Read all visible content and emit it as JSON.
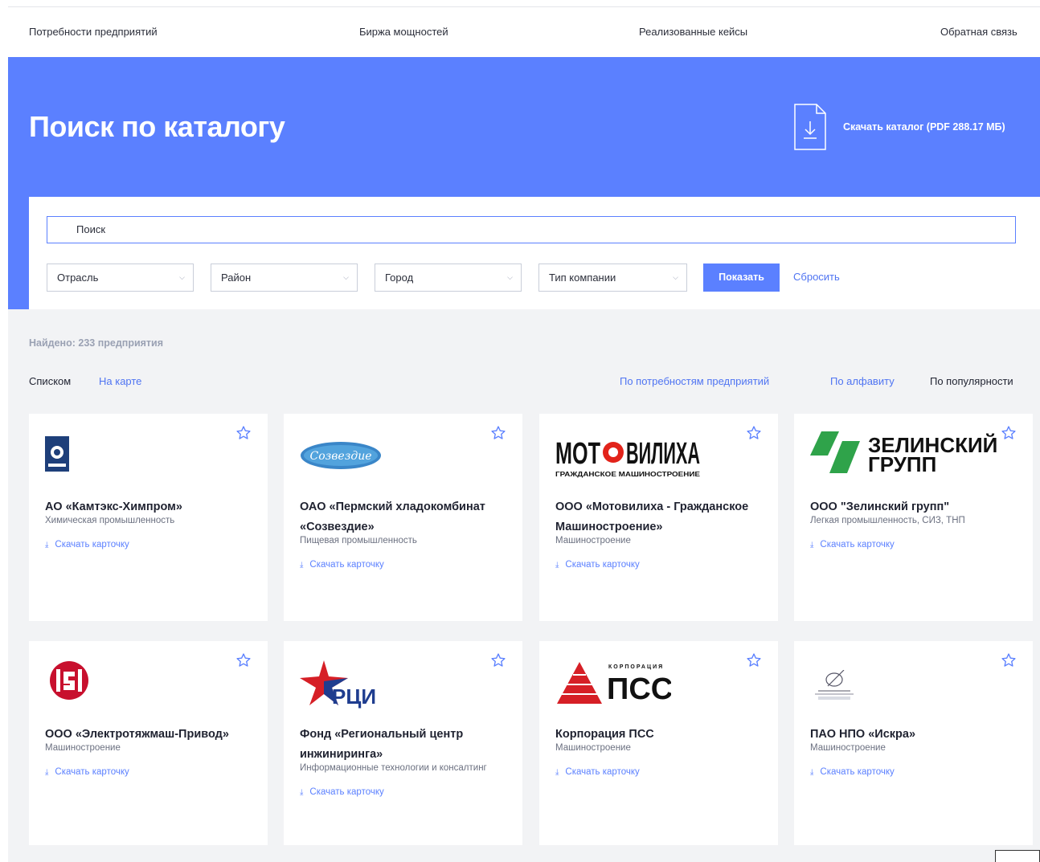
{
  "nav": {
    "items": [
      "Потребности предприятий",
      "Биржа мощностей",
      "Реализованные кейсы",
      "Обратная связь"
    ]
  },
  "hero": {
    "title": "Поиск по каталогу",
    "download_label": "Скачать каталог (PDF 288.17 МБ)"
  },
  "search": {
    "placeholder": "Поиск",
    "filters": [
      "Отрасль",
      "Район",
      "Город",
      "Тип компании"
    ],
    "show_button": "Показать",
    "reset_link": "Сбросить"
  },
  "results": {
    "found_text": "Найдено: 233 предприятия",
    "view_list": "Списком",
    "view_map": "На карте",
    "sort_needs": "По потребностям предприятий",
    "sort_alpha": "По алфавиту",
    "sort_popular": "По популярности"
  },
  "cards": [
    {
      "name": "АО «Камтэкс-Химпром»",
      "industry": "Химическая промышленность",
      "download": "Скачать карточку",
      "logo_icon": "kamteks-logo-icon"
    },
    {
      "name": "ОАО «Пермский хладокомбинат «Созвездие»",
      "industry": "Пищевая промышленность",
      "download": "Скачать карточку",
      "logo_icon": "sozvezdie-logo-icon",
      "logo_text": "Созвездие"
    },
    {
      "name": "ООО «Мотовилиха - Гражданское Машиностроение»",
      "industry": "Машиностроение",
      "download": "Скачать карточку",
      "logo_icon": "motovilikha-logo-icon",
      "logo_text_1": "МОТ",
      "logo_text_2": "ВИЛИХА",
      "logo_sub": "ГРАЖДАНСКОЕ МАШИНОСТРОЕНИЕ"
    },
    {
      "name": "ООО \"Зелинский групп\"",
      "industry": "Легкая промышленность, СИЗ, ТНП",
      "download": "Скачать карточку",
      "logo_icon": "zelinsky-logo-icon",
      "logo_text_1": "ЗЕЛИНСКИЙ",
      "logo_text_2": "ГРУПП"
    },
    {
      "name": "ООО «Электротяжмаш-Привод»",
      "industry": "Машиностроение",
      "download": "Скачать карточку",
      "logo_icon": "elektrotyazhmash-logo-icon"
    },
    {
      "name": "Фонд «Региональный центр инжиниринга»",
      "industry": "Информационные технологии и консалтинг",
      "download": "Скачать карточку",
      "logo_icon": "rci-logo-icon",
      "logo_text": "РЦИ"
    },
    {
      "name": "Корпорация ПСС",
      "industry": "Машиностроение",
      "download": "Скачать карточку",
      "logo_icon": "pss-logo-icon",
      "logo_text": "ПСС",
      "logo_sub": "КОРПОРАЦИЯ"
    },
    {
      "name": "ПАО НПО «Искра»",
      "industry": "Машиностроение",
      "download": "Скачать карточку",
      "logo_icon": "iskra-logo-icon"
    }
  ],
  "colors": {
    "brand_blue": "#5b80ff",
    "link_blue": "#4f74f2",
    "page_gray": "#f2f3f5",
    "motovilikha_red": "#e2231a",
    "zelinsky_green": "#2fa34a",
    "pss_red": "#d61f26",
    "rci_blue": "#1f3d8f"
  }
}
